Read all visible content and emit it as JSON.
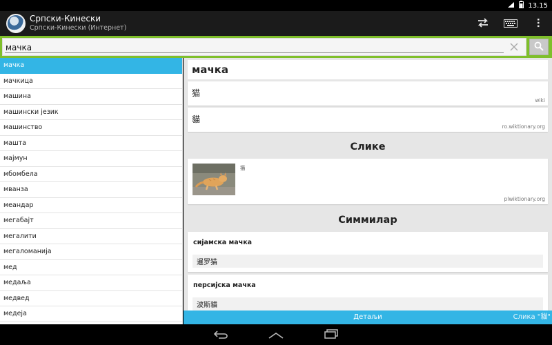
{
  "statusbar": {
    "time": "13.15"
  },
  "app": {
    "title": "Српски-Кинески",
    "subtitle": "Српски-Кинески (Интернет)"
  },
  "toolbar": {
    "swap_icon": "swap-icon",
    "keyboard_icon": "keyboard-icon",
    "overflow_icon": "overflow-menu-icon"
  },
  "search": {
    "value": "мачка",
    "placeholder": ""
  },
  "word_list": [
    "мачка",
    "мачкица",
    "машина",
    "машински језик",
    "машинство",
    "машта",
    "мајмун",
    "мбомбела",
    "мванза",
    "меандар",
    "мегабајт",
    "мегалити",
    "мегаломанија",
    "мед",
    "медаља",
    "медвед",
    "медеја"
  ],
  "selected_index": 0,
  "entry": {
    "word": "мачка",
    "translations": [
      {
        "text": "猫",
        "source": "wiki"
      },
      {
        "text": "貓",
        "source": "ro.wiktionary.org"
      }
    ],
    "images_title": "Слике",
    "image": {
      "caption": "猫",
      "source": "plwiktionary.org"
    },
    "similar_title": "Симмилар",
    "similar": [
      {
        "term": "сијамска мачка",
        "translation": "暹罗猫"
      },
      {
        "term": "персијска мачка",
        "translation": "波斯貓"
      }
    ]
  },
  "bottom": {
    "details_label": "Детаљи",
    "images_label": "Слика \"貓\""
  },
  "colors": {
    "accent_blue": "#33b5e5",
    "search_green": "#7fbf2b",
    "actionbar": "#1b1b1b"
  }
}
